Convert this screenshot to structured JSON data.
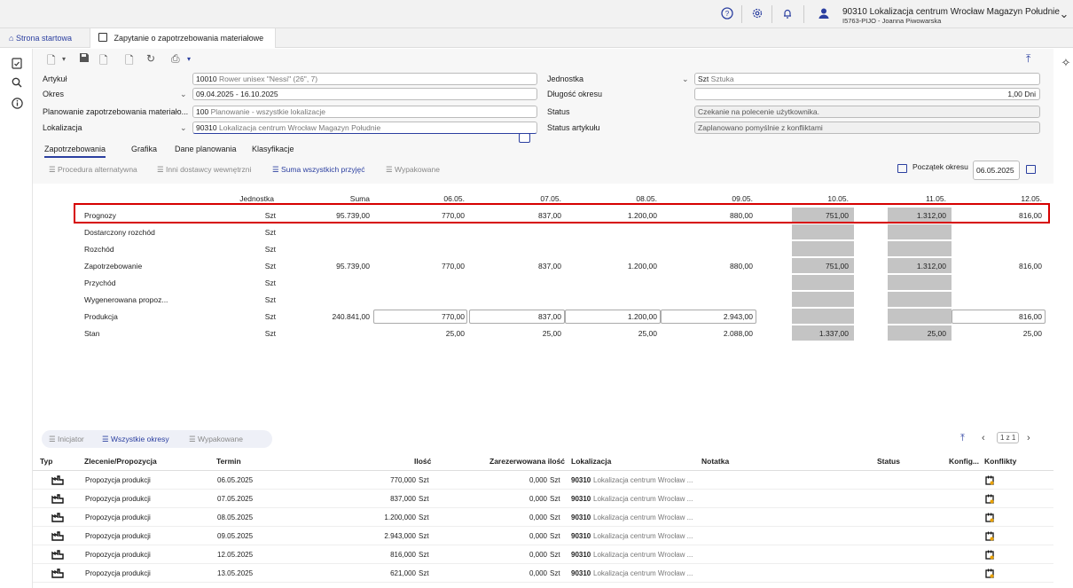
{
  "topbar": {
    "user_name": "90310 Lokalizacja centrum Wrocław Magazyn Południe",
    "user_sub": "I5763-PIJO - Joanna Piwowarska"
  },
  "tabs": {
    "home": "Strona startowa",
    "active": "Zapytanie o zapotrzebowania materiałowe"
  },
  "form": {
    "artykul_label": "Artykuł",
    "artykul_code": "10010",
    "artykul_desc": "Rower unisex \"Nessi\" (26\", 7)",
    "okres_label": "Okres",
    "okres_value": "09.04.2025 - 16.10.2025",
    "planowanie_label": "Planowanie zapotrzebowania materiało...",
    "planowanie_code": "100",
    "planowanie_desc": "Planowanie - wszystkie lokalizacje",
    "lokalizacja_label": "Lokalizacja",
    "lokalizacja_code": "90310",
    "lokalizacja_desc": "Lokalizacja centrum Wrocław Magazyn Południe",
    "jednostka_label": "Jednostka",
    "jednostka_code": "Szt",
    "jednostka_desc": "Sztuka",
    "dlugosc_label": "Długość okresu",
    "dlugosc_value": "1,00 Dni",
    "status_label": "Status",
    "status_value": "Czekanie na polecenie użytkownika.",
    "status_art_label": "Status artykułu",
    "status_art_value": "Zaplanowano pomyślnie z konfliktami"
  },
  "subtabs": [
    "Zapotrzebowania",
    "Grafika",
    "Dane planowania",
    "Klasyfikacje"
  ],
  "sections": [
    "Procedura alternatywna",
    "Inni dostawcy wewnętrzni",
    "Suma wszystkich przyjęć",
    "Wypakowane"
  ],
  "start": {
    "label": "Początek okresu",
    "value": "06.05.2025"
  },
  "grid": {
    "headers": [
      "Jednostka",
      "Suma",
      "06.05.",
      "07.05.",
      "08.05.",
      "09.05.",
      "10.05.",
      "11.05.",
      "12.05."
    ],
    "rows": [
      {
        "label": "Prognozy",
        "unit": "Szt",
        "sum": "95.739,00",
        "vals": [
          "770,00",
          "837,00",
          "1.200,00",
          "880,00",
          "751,00",
          "1.312,00",
          "816,00"
        ]
      },
      {
        "label": "Dostarczony rozchód",
        "unit": "Szt",
        "sum": "",
        "vals": [
          "",
          "",
          "",
          "",
          "",
          "",
          ""
        ]
      },
      {
        "label": "Rozchód",
        "unit": "Szt",
        "sum": "",
        "vals": [
          "",
          "",
          "",
          "",
          "",
          "",
          ""
        ]
      },
      {
        "label": "Zapotrzebowanie",
        "unit": "Szt",
        "sum": "95.739,00",
        "vals": [
          "770,00",
          "837,00",
          "1.200,00",
          "880,00",
          "751,00",
          "1.312,00",
          "816,00"
        ]
      },
      {
        "label": "Przychód",
        "unit": "Szt",
        "sum": "",
        "vals": [
          "",
          "",
          "",
          "",
          "",
          "",
          ""
        ]
      },
      {
        "label": "Wygenerowana propoz...",
        "unit": "Szt",
        "sum": "",
        "vals": [
          "",
          "",
          "",
          "",
          "",
          "",
          ""
        ]
      },
      {
        "label": "Produkcja",
        "unit": "Szt",
        "sum": "240.841,00",
        "vals": [
          "770,00",
          "837,00",
          "1.200,00",
          "2.943,00",
          "",
          "",
          "816,00"
        ]
      },
      {
        "label": "Stan",
        "unit": "Szt",
        "sum": "",
        "vals": [
          "25,00",
          "25,00",
          "25,00",
          "2.088,00",
          "1.337,00",
          "25,00",
          "25,00"
        ]
      }
    ]
  },
  "lower": {
    "sections": [
      "Inicjator",
      "Wszystkie okresy",
      "Wypakowane"
    ],
    "pager": "1 z 1",
    "headers": [
      "Typ",
      "Zlecenie/Propozycja",
      "Termin",
      "Ilość",
      "Zarezerwowana ilość",
      "Lokalizacja",
      "Notatka",
      "Status",
      "Konfig...",
      "Konflikty"
    ],
    "rows": [
      {
        "order": "Propozycja produkcji",
        "date": "06.05.2025",
        "qty": "770,000",
        "qunit": "Szt",
        "res": "0,000",
        "runit": "Szt",
        "loc_code": "90310",
        "loc_desc": "Lokalizacja centrum Wrocław ..."
      },
      {
        "order": "Propozycja produkcji",
        "date": "07.05.2025",
        "qty": "837,000",
        "qunit": "Szt",
        "res": "0,000",
        "runit": "Szt",
        "loc_code": "90310",
        "loc_desc": "Lokalizacja centrum Wrocław ..."
      },
      {
        "order": "Propozycja produkcji",
        "date": "08.05.2025",
        "qty": "1.200,000",
        "qunit": "Szt",
        "res": "0,000",
        "runit": "Szt",
        "loc_code": "90310",
        "loc_desc": "Lokalizacja centrum Wrocław ..."
      },
      {
        "order": "Propozycja produkcji",
        "date": "09.05.2025",
        "qty": "2.943,000",
        "qunit": "Szt",
        "res": "0,000",
        "runit": "Szt",
        "loc_code": "90310",
        "loc_desc": "Lokalizacja centrum Wrocław ..."
      },
      {
        "order": "Propozycja produkcji",
        "date": "12.05.2025",
        "qty": "816,000",
        "qunit": "Szt",
        "res": "0,000",
        "runit": "Szt",
        "loc_code": "90310",
        "loc_desc": "Lokalizacja centrum Wrocław ..."
      },
      {
        "order": "Propozycja produkcji",
        "date": "13.05.2025",
        "qty": "621,000",
        "qunit": "Szt",
        "res": "0,000",
        "runit": "Szt",
        "loc_code": "90310",
        "loc_desc": "Lokalizacja centrum Wrocław ..."
      }
    ]
  },
  "colors": {
    "accent": "#2b3fa0",
    "highlight": "#d60000",
    "grey_cell": "#c4c4c4"
  }
}
